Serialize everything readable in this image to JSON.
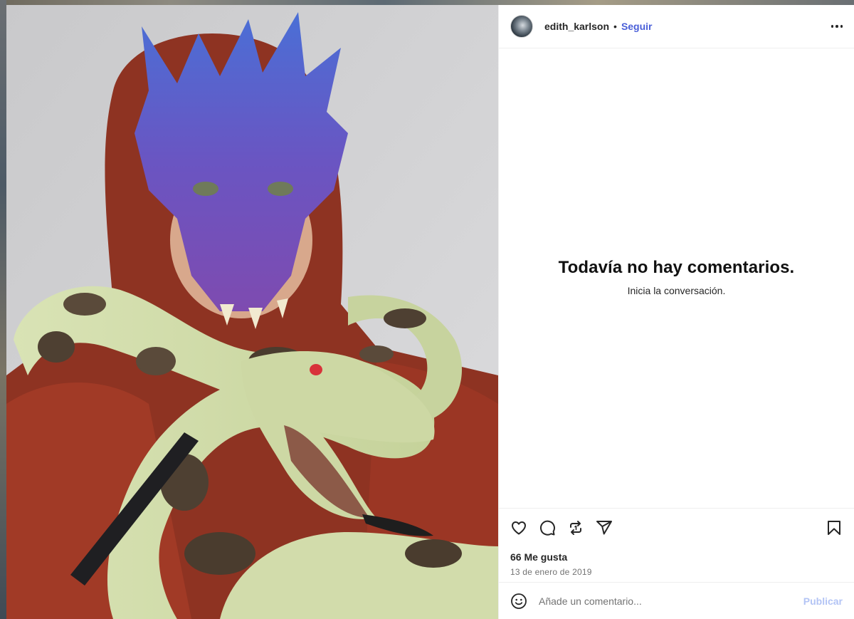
{
  "post": {
    "image_description_icon": "photo-image",
    "header": {
      "username": "edith_karlson",
      "separator": "•",
      "follow_label": "Seguir",
      "more_icon": "more-horizontal-icon"
    },
    "comments": {
      "empty_title": "Todavía no hay comentarios.",
      "empty_subtitle": "Inicia la conversación."
    },
    "actions": {
      "like_icon": "heart-icon",
      "comment_icon": "comment-icon",
      "repost_icon": "repost-icon",
      "share_icon": "send-icon",
      "save_icon": "bookmark-icon"
    },
    "likes_text": "66 Me gusta",
    "date_text": "13 de enero de 2019",
    "comment_bar": {
      "emoji_icon": "emoji-icon",
      "placeholder": "Añade un comentario...",
      "publish_label": "Publicar"
    }
  },
  "colors": {
    "accent": "#4a5fd8",
    "publish_disabled": "#b3c4f5",
    "text_primary": "#262626",
    "text_secondary": "#737373",
    "divider": "#efefef"
  }
}
